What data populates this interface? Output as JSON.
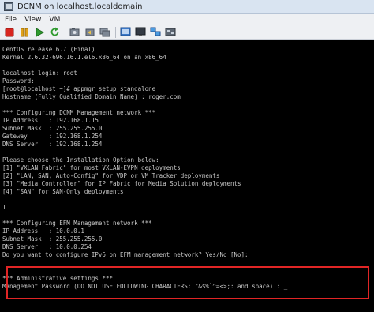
{
  "window": {
    "title": "DCNM on localhost.localdomain"
  },
  "menu": [
    "File",
    "View",
    "VM"
  ],
  "toolbar": {
    "buttons": [
      "stop-button",
      "pause-button",
      "play-button",
      "refresh-button",
      "snapshot-button",
      "snapshot-revert-button",
      "snapshot-manager-button",
      "fullscreen-button",
      "console-view-button",
      "unity-button",
      "settings-button"
    ]
  },
  "console": {
    "lines": [
      "CentOS release 6.7 (Final)",
      "Kernel 2.6.32-696.16.1.el6.x86_64 on an x86_64",
      "",
      "localhost login: root",
      "Password:",
      "[root@localhost ~]# appmgr setup standalone",
      "Hostname (Fully Qualified Domain Name) : roger.com",
      "",
      "*** Configuring DCNM Management network ***",
      "IP Address   : 192.168.1.15",
      "Subnet Mask  : 255.255.255.0",
      "Gateway      : 192.168.1.254",
      "DNS Server   : 192.168.1.254",
      "",
      "Please choose the Installation Option below:",
      "[1] \"VXLAN Fabric\" for most VXLAN-EVPN deployments",
      "[2] \"LAN, SAN, Auto-Config\" for VDP or VM Tracker deployments",
      "[3] \"Media Controller\" for IP Fabric for Media Solution deployments",
      "[4] \"SAN\" for SAN-Only deployments",
      "",
      "1",
      "",
      "*** Configuring EFM Management network ***",
      "IP Address   : 10.0.0.1",
      "Subnet Mask  : 255.255.255.0",
      "DNS Server   : 10.0.0.254",
      "Do you want to configure IPv6 on EFM management network? Yes/No [No]:",
      "",
      "",
      "*** Administrative settings ***",
      "Management Password (DO NOT USE FOLLOWING CHARACTERS: \"&$%`^=<>;: and space) : _"
    ]
  },
  "colors": {
    "console_bg": "#000000",
    "console_text": "#c8c8c8",
    "highlight_border": "#e02525",
    "titlebar_bg": "#d9e4f1"
  }
}
